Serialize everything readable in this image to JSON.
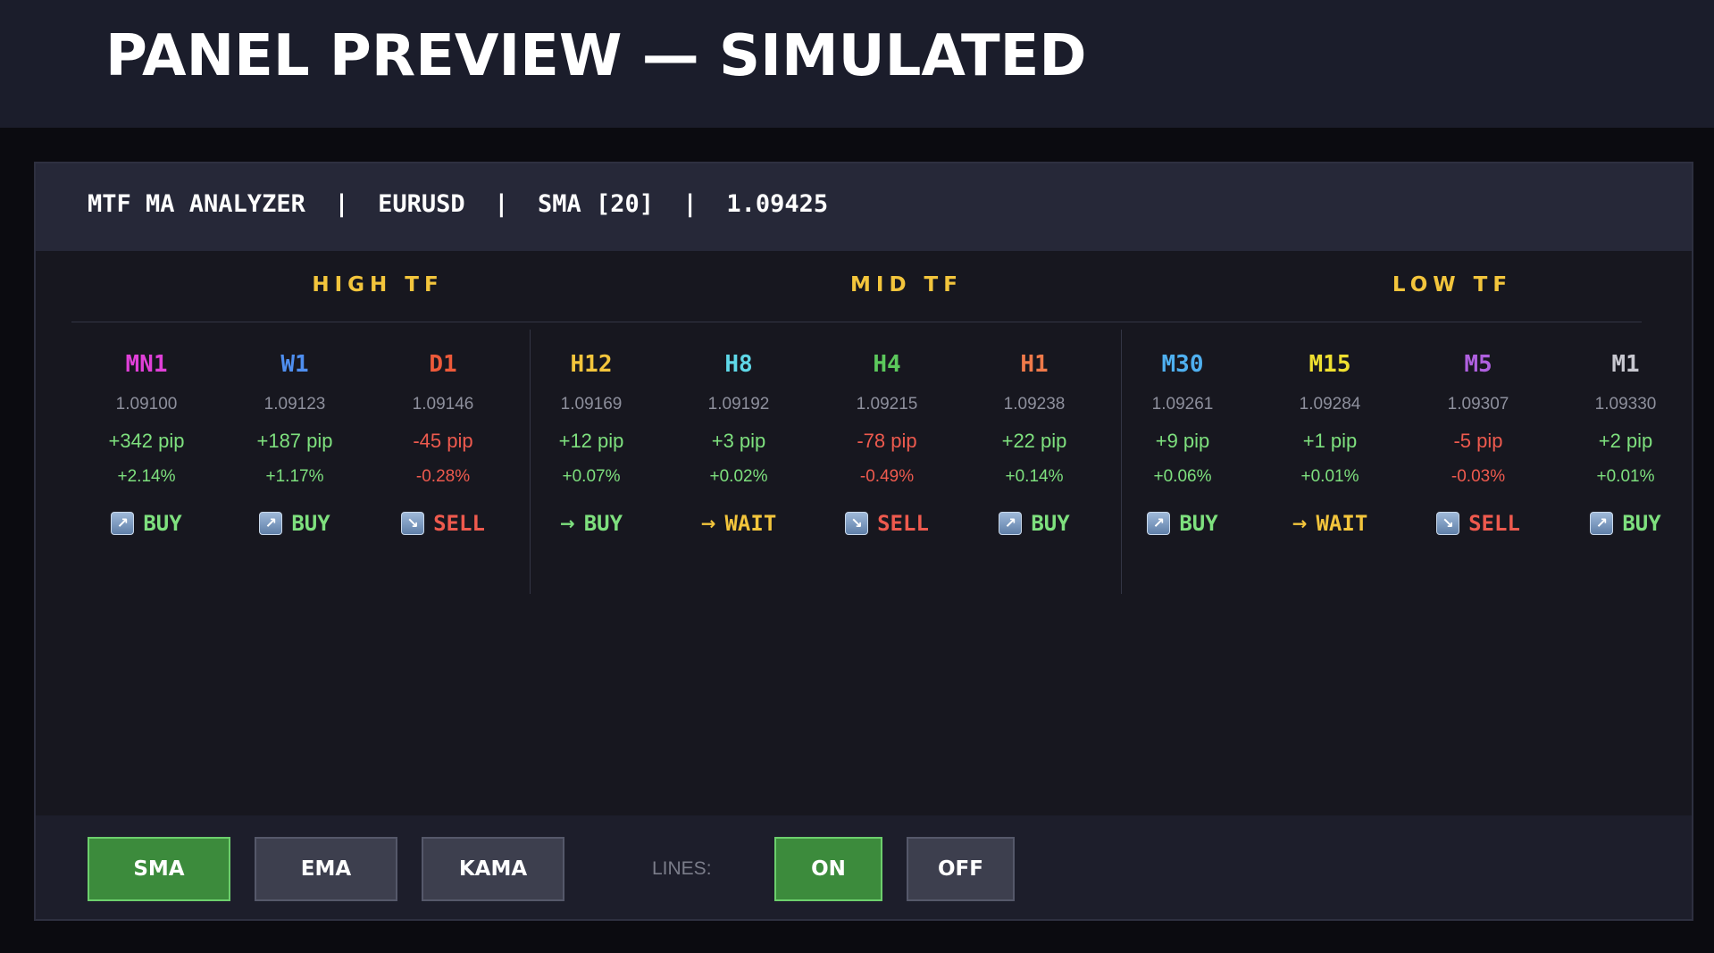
{
  "page_title": "PANEL PREVIEW — SIMULATED",
  "header": {
    "app": "MTF MA ANALYZER",
    "symbol": "EURUSD",
    "ma": "SMA [20]",
    "price": "1.09425",
    "separator": "|"
  },
  "groups": [
    {
      "label": "HIGH TF"
    },
    {
      "label": "MID TF"
    },
    {
      "label": "LOW TF"
    }
  ],
  "timeframes": [
    {
      "name": "MN1",
      "color": "#e040d8",
      "price": "1.09100",
      "pip": "+342 pip",
      "pct": "+2.14%",
      "trend": "up",
      "signal": "BUY",
      "icon": "arrow-up-right-icon"
    },
    {
      "name": "W1",
      "color": "#4f8ff0",
      "price": "1.09123",
      "pip": "+187 pip",
      "pct": "+1.17%",
      "trend": "up",
      "signal": "BUY",
      "icon": "arrow-up-right-icon"
    },
    {
      "name": "D1",
      "color": "#ee5a3a",
      "price": "1.09146",
      "pip": "-45 pip",
      "pct": "-0.28%",
      "trend": "down",
      "signal": "SELL",
      "icon": "arrow-down-right-icon"
    },
    {
      "name": "H12",
      "color": "#f3c53c",
      "price": "1.09169",
      "pip": "+12 pip",
      "pct": "+0.07%",
      "trend": "up",
      "signal": "BUY",
      "icon": "arrow-right-icon"
    },
    {
      "name": "H8",
      "color": "#5fd8e8",
      "price": "1.09192",
      "pip": "+3 pip",
      "pct": "+0.02%",
      "trend": "up",
      "signal": "WAIT",
      "icon": "arrow-right-icon"
    },
    {
      "name": "H4",
      "color": "#5cc85c",
      "price": "1.09215",
      "pip": "-78 pip",
      "pct": "-0.49%",
      "trend": "down",
      "signal": "SELL",
      "icon": "arrow-down-right-icon"
    },
    {
      "name": "H1",
      "color": "#f07a4a",
      "price": "1.09238",
      "pip": "+22 pip",
      "pct": "+0.14%",
      "trend": "up",
      "signal": "BUY",
      "icon": "arrow-up-right-icon"
    },
    {
      "name": "M30",
      "color": "#4fb0f0",
      "price": "1.09261",
      "pip": "+9 pip",
      "pct": "+0.06%",
      "trend": "up",
      "signal": "BUY",
      "icon": "arrow-up-right-icon"
    },
    {
      "name": "M15",
      "color": "#f0e030",
      "price": "1.09284",
      "pip": "+1 pip",
      "pct": "+0.01%",
      "trend": "up",
      "signal": "WAIT",
      "icon": "arrow-right-icon"
    },
    {
      "name": "M5",
      "color": "#b060e0",
      "price": "1.09307",
      "pip": "-5 pip",
      "pct": "-0.03%",
      "trend": "down",
      "signal": "SELL",
      "icon": "arrow-down-right-icon"
    },
    {
      "name": "M1",
      "color": "#c8c8d0",
      "price": "1.09330",
      "pip": "+2 pip",
      "pct": "+0.01%",
      "trend": "up",
      "signal": "BUY",
      "icon": "arrow-up-right-icon"
    }
  ],
  "footer": {
    "ma_buttons": [
      {
        "label": "SMA",
        "active": true
      },
      {
        "label": "EMA",
        "active": false
      },
      {
        "label": "KAMA",
        "active": false
      }
    ],
    "lines_label": "LINES:",
    "lines_buttons": [
      {
        "label": "ON",
        "active": true
      },
      {
        "label": "OFF",
        "active": false
      }
    ]
  }
}
